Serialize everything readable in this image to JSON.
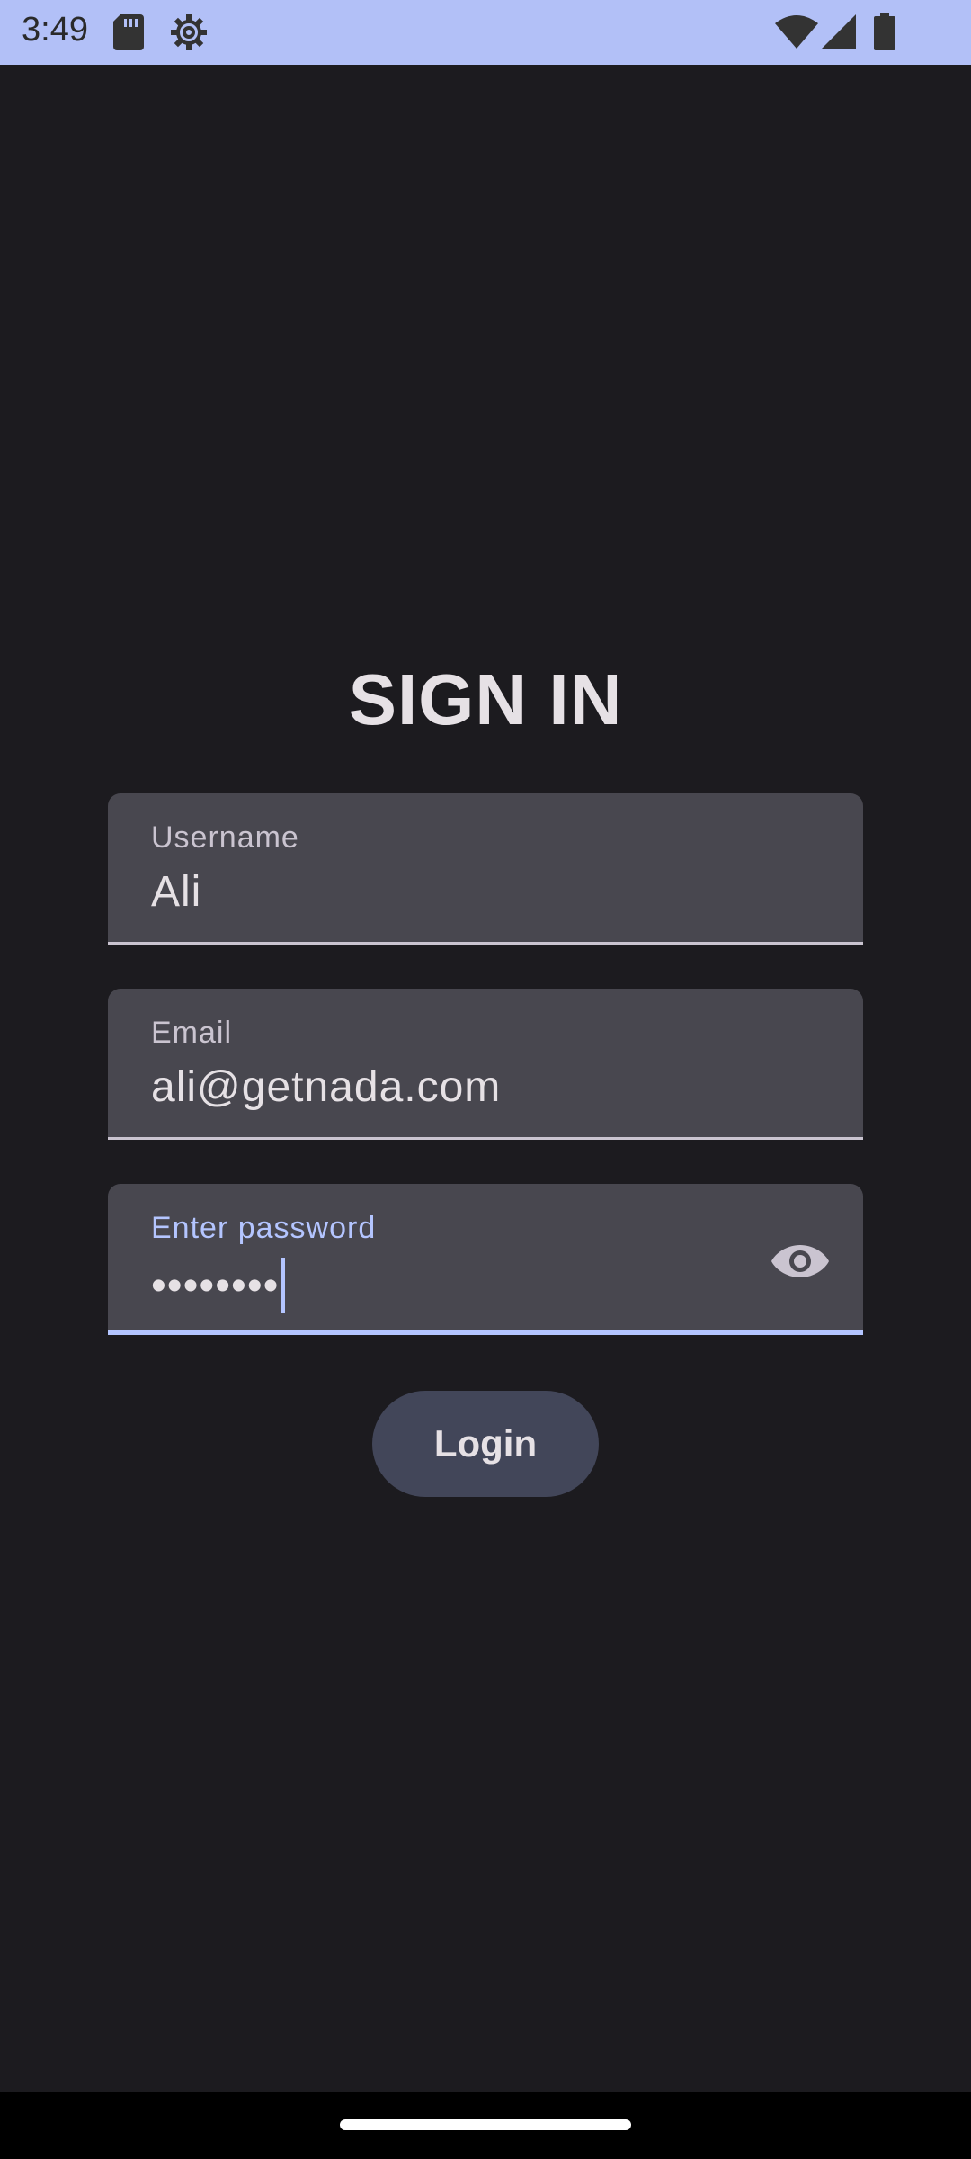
{
  "status_bar": {
    "time": "3:49",
    "icons": [
      "sd-card-icon",
      "gear-icon",
      "wifi-icon",
      "cell-signal-icon",
      "battery-icon"
    ]
  },
  "title": "SIGN IN",
  "fields": {
    "username": {
      "label": "Username",
      "value": "Ali"
    },
    "email": {
      "label": "Email",
      "value": "ali@getnada.com"
    },
    "password": {
      "label": "Enter password",
      "value": "••••••••"
    }
  },
  "login_button": {
    "label": "Login"
  },
  "colors": {
    "background": "#1c1b1f",
    "status_bar": "#b2c0f7",
    "field_bg": "#48474f",
    "accent": "#b4c5ff",
    "button_bg": "#424659",
    "text": "#e6e1e5"
  }
}
